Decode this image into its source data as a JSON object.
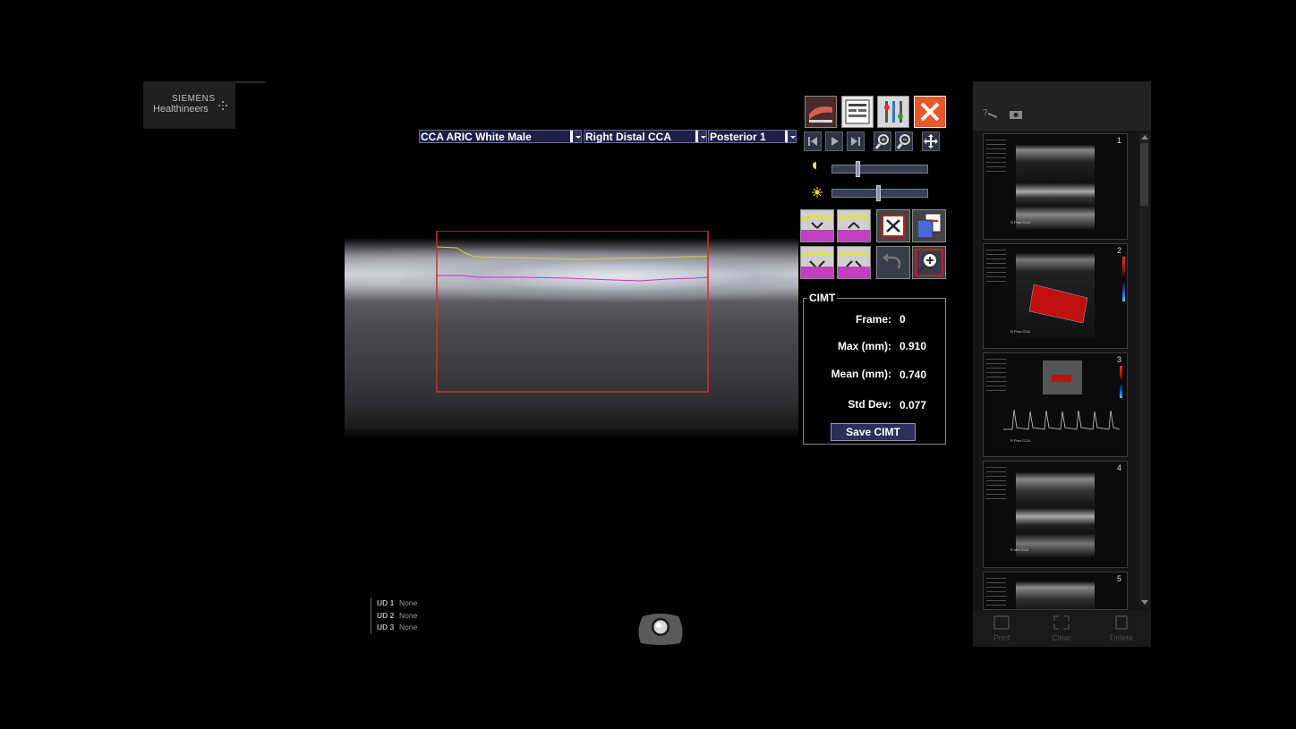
{
  "logo": {
    "line1": "SIEMENS",
    "line2": "Healthineers"
  },
  "dropdowns": [
    {
      "value": "CCA ARIC White Male"
    },
    {
      "value": "Right Distal CCA"
    },
    {
      "value": "Posterior 1"
    }
  ],
  "toolbar": {
    "top_icons": [
      "vessel-icon",
      "report-icon",
      "tools-icon",
      "close-icon"
    ],
    "playback_icons": [
      "first-frame-icon",
      "play-icon",
      "last-frame-icon",
      "zoom-in-icon",
      "zoom-out-icon",
      "pan-icon"
    ],
    "edit_icons": [
      "trace-adjust-icon",
      "trace-adjust-icon",
      "delete-trace-icon",
      "copy-icon",
      "trace-adjust-icon",
      "trace-adjust-icon",
      "undo-icon",
      "zoom-region-icon"
    ]
  },
  "sliders": [
    {
      "icon": "contrast-icon",
      "value_fraction": 0.26
    },
    {
      "icon": "brightness-icon",
      "value_fraction": 0.49
    }
  ],
  "cimt": {
    "title": "CIMT",
    "frame_label": "Frame:",
    "frame_value": "0",
    "max_label": "Max (mm):",
    "max_value": "0.910",
    "mean_label": "Mean (mm):",
    "mean_value": "0.740",
    "std_label": "Std Dev:",
    "std_value": "0.077",
    "save_label": "Save CIMT"
  },
  "colors": {
    "roi_box": "#e0262a",
    "upper_trace": "#d8d040",
    "lower_trace": "#d030d0",
    "button_bg": "#2b3058"
  },
  "header_icons": [
    "help-icon",
    "camera-icon"
  ],
  "thumbnails": [
    {
      "number": "1",
      "label": "R Prox CCA",
      "type": "bmode"
    },
    {
      "number": "2",
      "label": "R Prox CCA",
      "type": "color"
    },
    {
      "number": "3",
      "label": "R Prox CCA",
      "type": "doppler"
    },
    {
      "number": "4",
      "label": "R Mid CCA",
      "type": "bmode"
    },
    {
      "number": "5",
      "label": "",
      "type": "bmode"
    }
  ],
  "footer": {
    "print": "Print",
    "clear": "Clear",
    "delete": "Delete"
  },
  "ud_legend": [
    {
      "key": "UD 1",
      "value": "None"
    },
    {
      "key": "UD 2",
      "value": "None"
    },
    {
      "key": "UD 3",
      "value": "None"
    }
  ]
}
